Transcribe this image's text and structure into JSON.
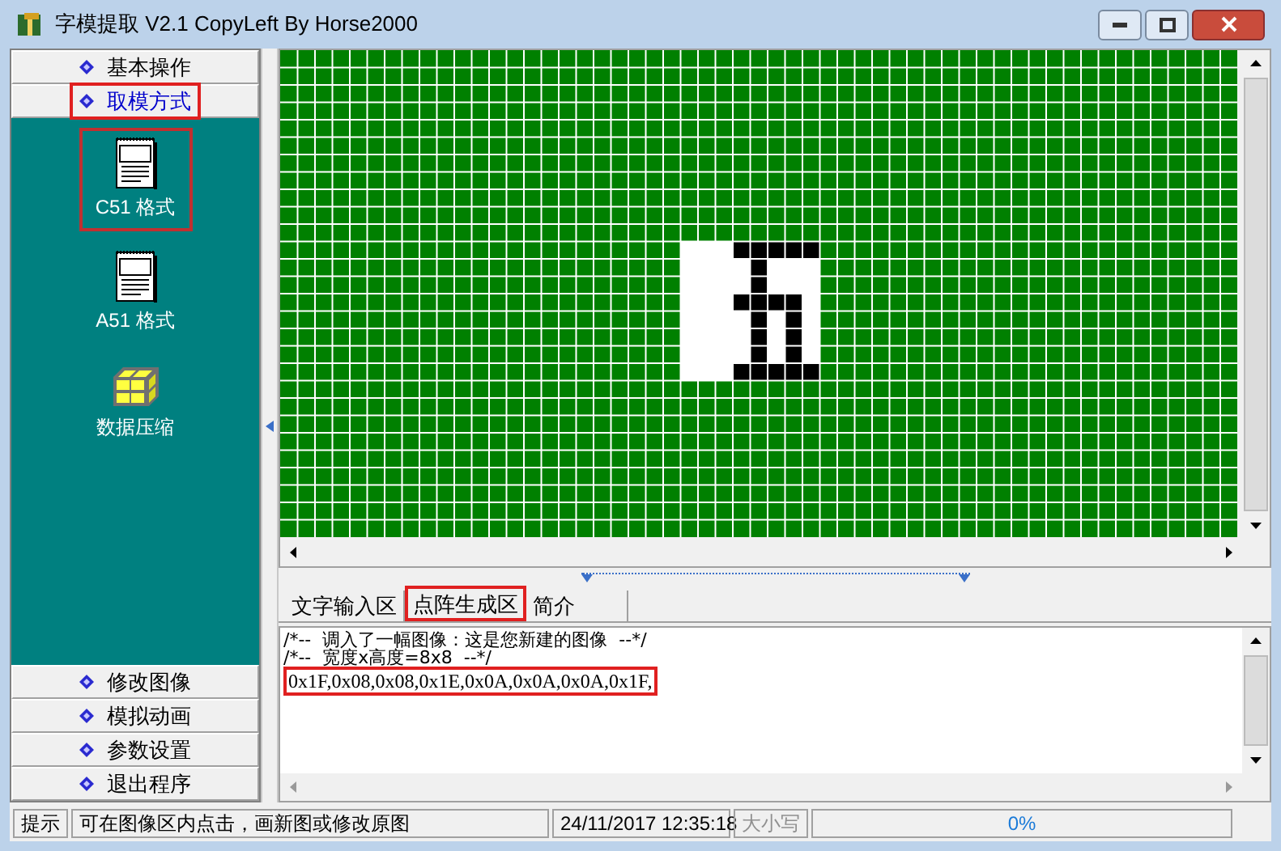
{
  "window": {
    "title": "字模提取 V2.1  CopyLeft By Horse2000"
  },
  "sidebar": {
    "groups_top": [
      {
        "label": "基本操作",
        "selected": false,
        "highlighted": false
      },
      {
        "label": "取模方式",
        "selected": true,
        "highlighted": true
      }
    ],
    "items": [
      {
        "label": "C51 格式",
        "kind": "c51",
        "highlighted": true
      },
      {
        "label": "A51 格式",
        "kind": "a51",
        "highlighted": false
      },
      {
        "label": "数据压缩",
        "kind": "compress",
        "highlighted": false
      }
    ],
    "groups_bottom": [
      {
        "label": "修改图像",
        "selected": false,
        "highlighted": false
      },
      {
        "label": "模拟动画",
        "selected": false,
        "highlighted": false
      },
      {
        "label": "参数设置",
        "selected": false,
        "highlighted": false
      },
      {
        "label": "退出程序",
        "selected": false,
        "highlighted": false
      }
    ]
  },
  "canvas": {
    "pixels": [
      [
        false,
        false,
        false,
        true,
        true,
        true,
        true,
        true
      ],
      [
        false,
        false,
        false,
        false,
        true,
        false,
        false,
        false
      ],
      [
        false,
        false,
        false,
        false,
        true,
        false,
        false,
        false
      ],
      [
        false,
        false,
        false,
        true,
        true,
        true,
        true,
        false
      ],
      [
        false,
        false,
        false,
        false,
        true,
        false,
        true,
        false
      ],
      [
        false,
        false,
        false,
        false,
        true,
        false,
        true,
        false
      ],
      [
        false,
        false,
        false,
        false,
        true,
        false,
        true,
        false
      ],
      [
        false,
        false,
        false,
        true,
        true,
        true,
        true,
        true
      ]
    ]
  },
  "tabs": [
    {
      "label": "文字输入区",
      "selected": false,
      "highlighted": false
    },
    {
      "label": "点阵生成区",
      "selected": true,
      "highlighted": true
    },
    {
      "label": "简介",
      "selected": false,
      "highlighted": false
    }
  ],
  "output_lines": [
    {
      "text": "/*--  调入了一幅图像：这是您新建的图像  --*/",
      "highlighted": false
    },
    {
      "text": "/*--  宽度x高度=8x8  --*/",
      "highlighted": false
    },
    {
      "text": "0x1F,0x08,0x08,0x1E,0x0A,0x0A,0x0A,0x1F,",
      "highlighted": true
    }
  ],
  "status_bar": {
    "label": "提示",
    "message": "可在图像区内点击，画新图或修改原图",
    "datetime": "24/11/2017 12:35:18",
    "caps": {
      "text": "大小写",
      "disabled": true
    },
    "progress": {
      "text": "0%",
      "level": 0
    }
  }
}
